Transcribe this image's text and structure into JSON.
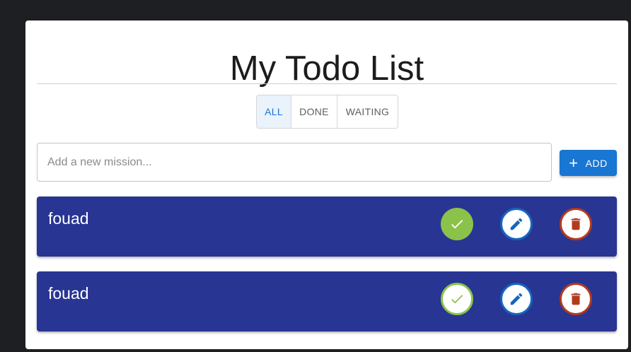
{
  "app": {
    "title": "My Todo List"
  },
  "filters": [
    {
      "label": "ALL",
      "active": true
    },
    {
      "label": "DONE",
      "active": false
    },
    {
      "label": "WAITING",
      "active": false
    }
  ],
  "add": {
    "placeholder": "Add a new mission...",
    "value": "",
    "button_label": "ADD",
    "button_icon": "plus-icon"
  },
  "todos": [
    {
      "text": "fouad",
      "done": true
    },
    {
      "text": "fouad",
      "done": false
    }
  ],
  "colors": {
    "page_background": "#1e1f22",
    "card_background": "#ffffff",
    "todo_background": "#283593",
    "accent_blue": "#1976d2",
    "done_green": "#8bc34a",
    "edit_blue": "#1565c0",
    "delete_red": "#b23a1f"
  },
  "icons": {
    "done": "check-icon",
    "edit": "pencil-icon",
    "delete": "trash-icon"
  }
}
